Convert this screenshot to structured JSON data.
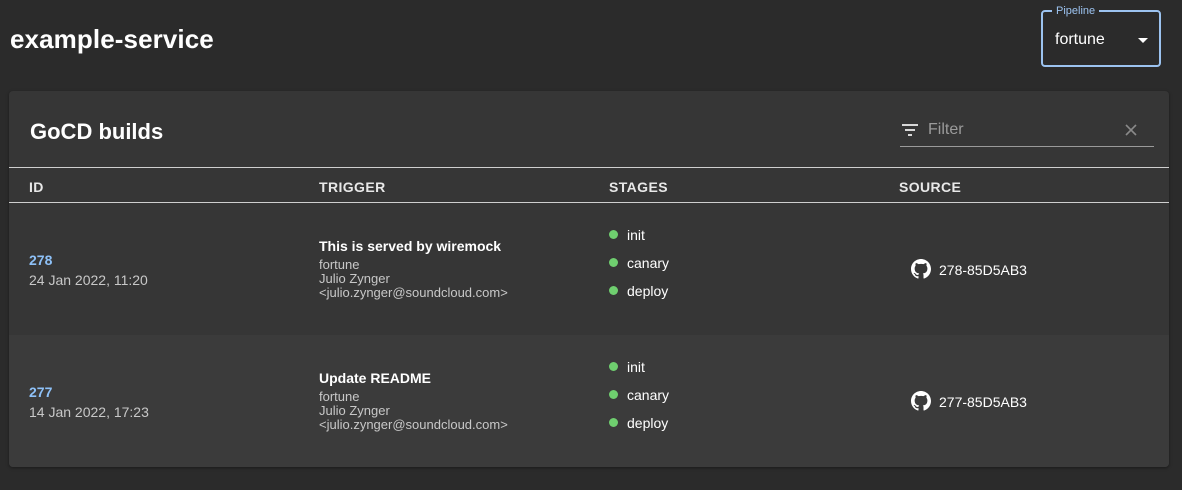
{
  "header": {
    "title": "example-service",
    "pipeline": {
      "legend": "Pipeline",
      "value": "fortune"
    }
  },
  "card": {
    "title": "GoCD builds",
    "filter": {
      "placeholder": "Filter",
      "value": ""
    },
    "columns": [
      "ID",
      "TRIGGER",
      "STAGES",
      "SOURCE"
    ],
    "rows": [
      {
        "id": "278",
        "date": "24 Jan 2022, 11:20",
        "trigger_title": "This is served by wiremock",
        "trigger_pipeline": "fortune",
        "trigger_author": "Julio Zynger",
        "trigger_email": "<julio.zynger@soundcloud.com>",
        "stages": [
          "init",
          "canary",
          "deploy"
        ],
        "source": "278-85D5AB3"
      },
      {
        "id": "277",
        "date": "14 Jan 2022, 17:23",
        "trigger_title": "Update README",
        "trigger_pipeline": "fortune",
        "trigger_author": "Julio Zynger",
        "trigger_email": "<julio.zynger@soundcloud.com>",
        "stages": [
          "init",
          "canary",
          "deploy"
        ],
        "source": "277-85D5AB3"
      }
    ]
  },
  "colors": {
    "background": "#2b2b2b",
    "card": "#363636",
    "link": "#8ec1f8",
    "stage_success": "#6fcf6f",
    "select_border": "#9cc3f0"
  },
  "icons": {
    "filter": "filter-icon",
    "clear": "close-icon",
    "source": "github-icon",
    "dropdown": "caret-down-icon"
  }
}
